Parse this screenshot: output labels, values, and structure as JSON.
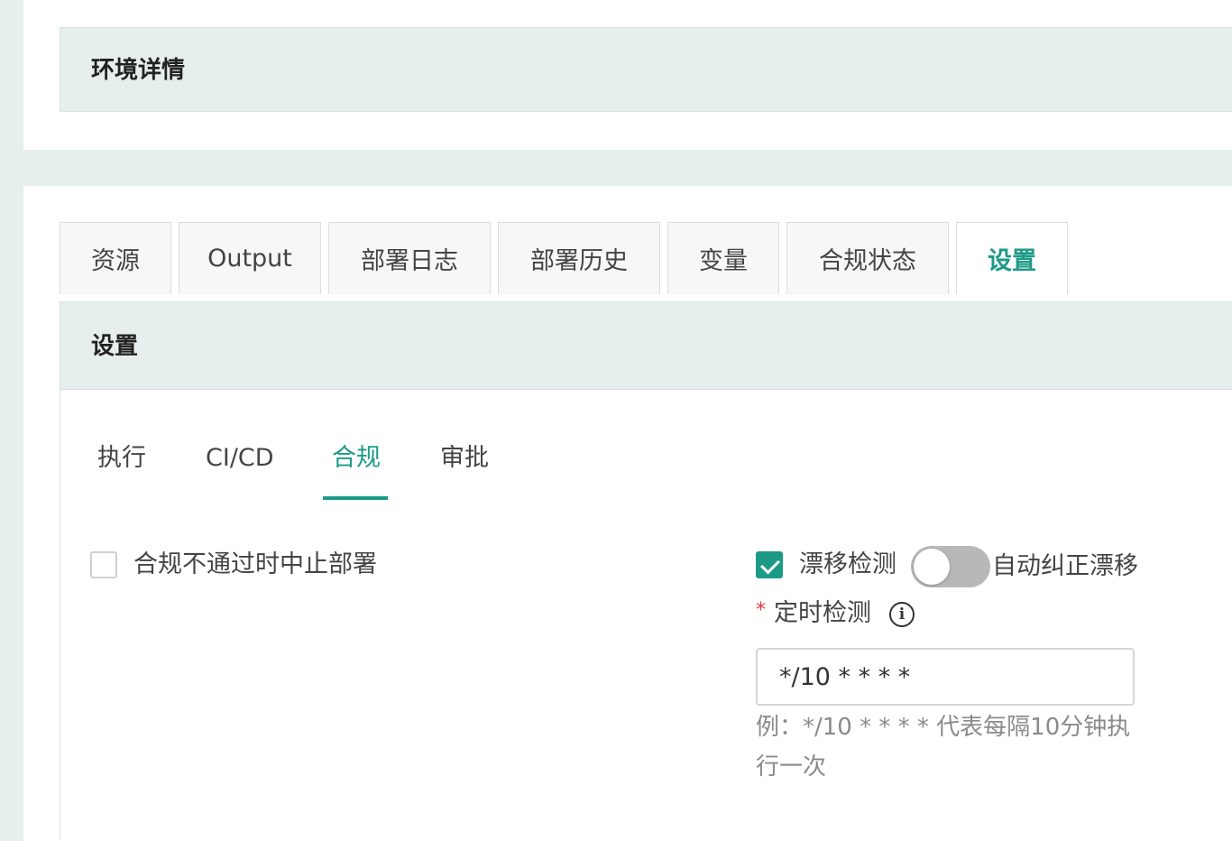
{
  "env": {
    "title": "环境详情"
  },
  "tabs": [
    {
      "label": "资源"
    },
    {
      "label": "Output"
    },
    {
      "label": "部署日志"
    },
    {
      "label": "部署历史"
    },
    {
      "label": "变量"
    },
    {
      "label": "合规状态"
    },
    {
      "label": "设置",
      "active": true
    }
  ],
  "settings": {
    "title": "设置",
    "subtabs": [
      {
        "label": "执行"
      },
      {
        "label": "CI/CD"
      },
      {
        "label": "合规",
        "active": true
      },
      {
        "label": "审批"
      }
    ],
    "abort_on_noncompliance": {
      "label": "合规不通过时中止部署",
      "checked": false
    },
    "drift_detection": {
      "label": "漂移检测",
      "checked": true
    },
    "auto_correct": {
      "label": "自动纠正漂移",
      "enabled": false
    },
    "schedule": {
      "required_mark": "*",
      "label": "定时检测",
      "info_icon": "info-icon",
      "value": "*/10 * * * *",
      "hint": "例：*/10 * * * * 代表每隔10分钟执行一次"
    }
  },
  "colors": {
    "accent": "#1c9a86",
    "header_bg": "#e6efed",
    "page_bg": "#e5efec",
    "required": "#e0393e"
  }
}
